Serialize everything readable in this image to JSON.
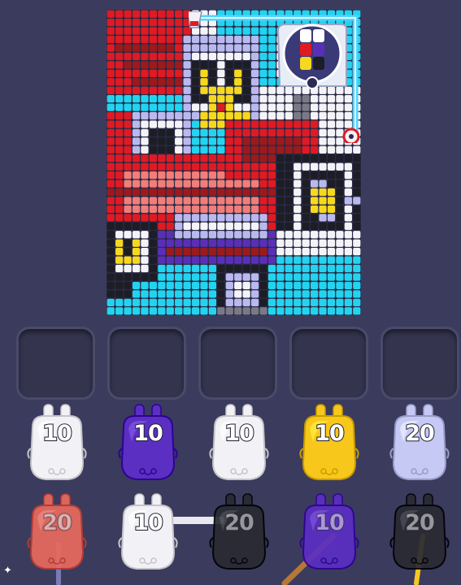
{
  "board": {
    "rows": 36,
    "cols": 30,
    "palette": {
      "R": "#e01a23",
      "P": "#f07e7a",
      "C": "#22d4f0",
      "W": "#f4f4f8",
      "K": "#1d1d26",
      "V": "#5a2fb8",
      "L": "#b9b9f0",
      "Y": "#f6d81e",
      "D": "#9c1a1c",
      "G": "#7a7a86"
    }
  },
  "slots": [
    {
      "state": "empty"
    },
    {
      "state": "empty"
    },
    {
      "state": "empty"
    },
    {
      "state": "empty"
    },
    {
      "state": "empty"
    }
  ],
  "queue_front": [
    {
      "count": "10",
      "color": "white"
    },
    {
      "count": "10",
      "color": "purple"
    },
    {
      "count": "10",
      "color": "white"
    },
    {
      "count": "10",
      "color": "yellow"
    },
    {
      "count": "20",
      "color": "lavender"
    }
  ],
  "queue_back": [
    {
      "count": "20",
      "color": "salmon"
    },
    {
      "count": "10",
      "color": "white"
    },
    {
      "count": "20",
      "color": "black"
    },
    {
      "count": "10",
      "color": "purple"
    },
    {
      "count": "20",
      "color": "black"
    }
  ],
  "colors": {
    "white": "#f2f2f6",
    "purple": "#5b2fc2",
    "yellow": "#f7c81b",
    "lavender": "#c7c9f5",
    "salmon": "#e96a5f",
    "black": "#2a2a33",
    "conveyor": "#4fd6ff",
    "slot_bg": "#34344f",
    "background": "#3b3b5e"
  },
  "corner_mark": "✦"
}
